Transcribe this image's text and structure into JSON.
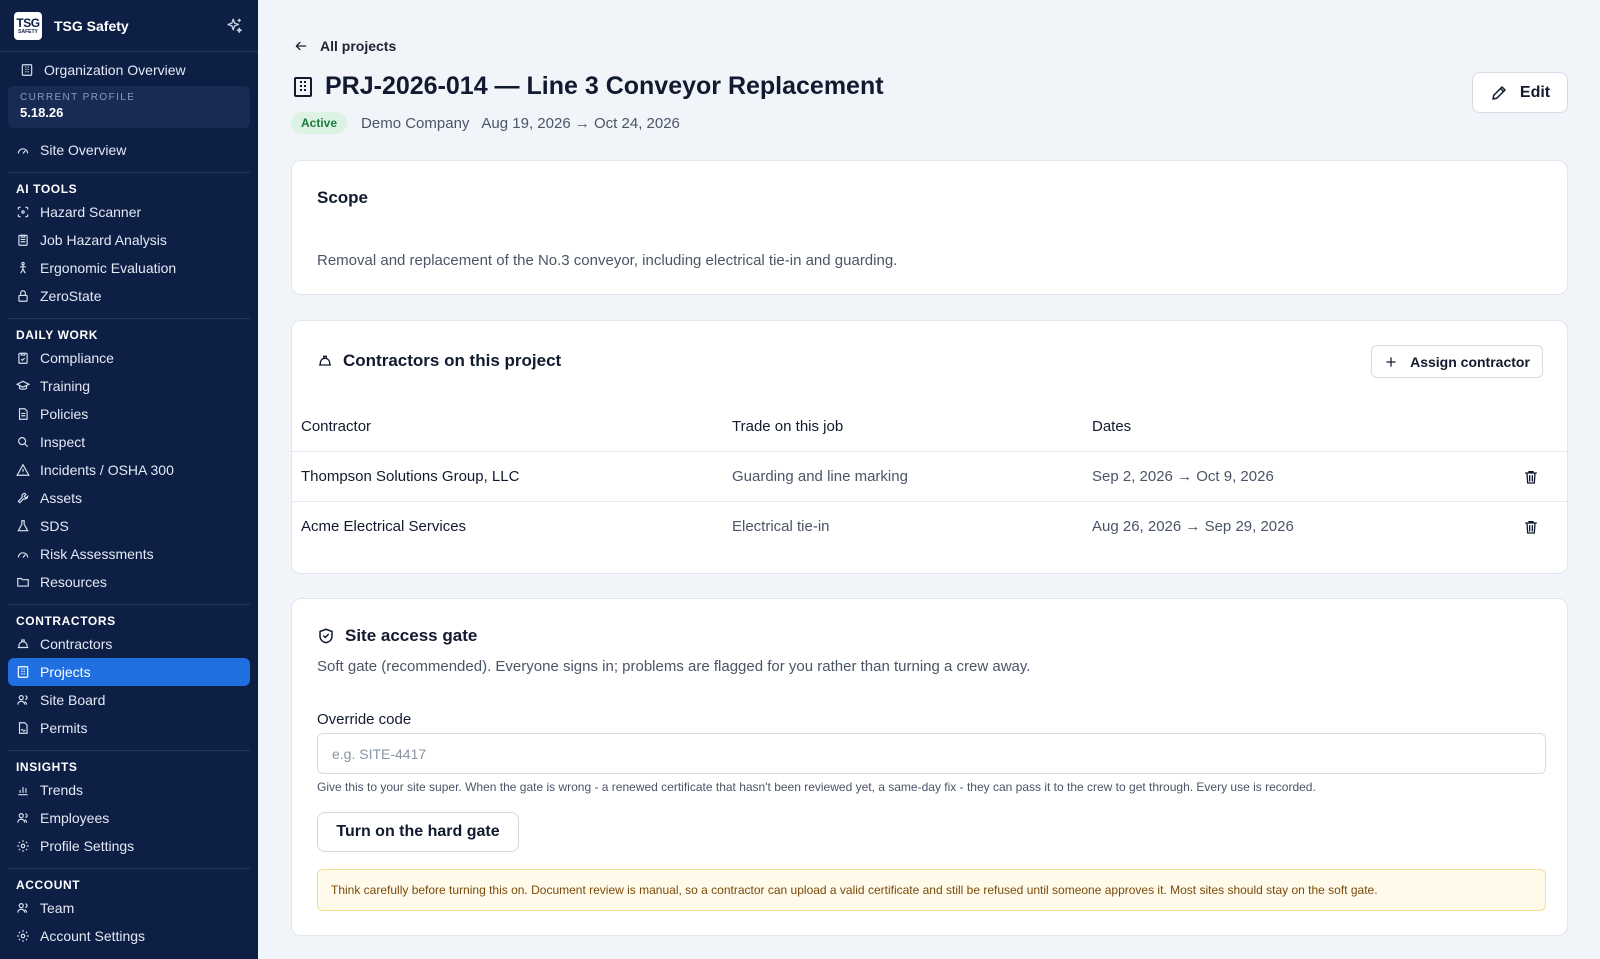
{
  "app": {
    "brand_logo_line1": "TSG",
    "brand_logo_line2": "SAFETY",
    "brand_name": "TSG Safety"
  },
  "sidebar": {
    "org_overview": "Organization Overview",
    "profile_label": "CURRENT PROFILE",
    "profile_value": "5.18.26",
    "site_overview": "Site Overview",
    "sections": {
      "ai_tools": {
        "title": "AI TOOLS",
        "items": [
          "Hazard Scanner",
          "Job Hazard Analysis",
          "Ergonomic Evaluation",
          "ZeroState"
        ]
      },
      "daily_work": {
        "title": "DAILY WORK",
        "items": [
          "Compliance",
          "Training",
          "Policies",
          "Inspect",
          "Incidents / OSHA 300",
          "Assets",
          "SDS",
          "Risk Assessments",
          "Resources"
        ]
      },
      "contractors": {
        "title": "CONTRACTORS",
        "items": [
          "Contractors",
          "Projects",
          "Site Board",
          "Permits"
        ],
        "active": "Projects"
      },
      "insights": {
        "title": "INSIGHTS",
        "items": [
          "Trends",
          "Employees",
          "Profile Settings"
        ]
      },
      "account": {
        "title": "ACCOUNT",
        "items": [
          "Team",
          "Account Settings"
        ]
      }
    }
  },
  "header": {
    "back_label": "All projects",
    "title": "PRJ-2026-014 — Line 3 Conveyor Replacement",
    "status": "Active",
    "company": "Demo Company",
    "dates": "Aug 19, 2026 → Oct 24, 2026",
    "edit_label": "Edit"
  },
  "scope": {
    "title": "Scope",
    "text": "Removal and replacement of the No.3 conveyor, including electrical tie-in and guarding."
  },
  "contractors_card": {
    "title": "Contractors on this project",
    "assign_label": "Assign contractor",
    "columns": [
      "Contractor",
      "Trade on this job",
      "Dates"
    ],
    "rows": [
      {
        "contractor": "Thompson Solutions Group, LLC",
        "trade": "Guarding and line marking",
        "dates": "Sep 2, 2026 → Oct 9, 2026"
      },
      {
        "contractor": "Acme Electrical Services",
        "trade": "Electrical tie-in",
        "dates": "Aug 26, 2026 → Sep 29, 2026"
      }
    ]
  },
  "gate": {
    "title": "Site access gate",
    "description": "Soft gate (recommended). Everyone signs in; problems are flagged for you rather than turning a crew away.",
    "override_label": "Override code",
    "override_placeholder": "e.g. SITE-4417",
    "override_value": "",
    "help": "Give this to your site super. When the gate is wrong - a renewed certificate that hasn't been reviewed yet, a same-day fix - they can pass it to the crew to get through. Every use is recorded.",
    "hard_gate_label": "Turn on the hard gate",
    "warning": "Think carefully before turning this on. Document review is manual, so a contractor can upload a valid certificate and still be refused until someone approves it. Most sites should stay on the soft gate."
  },
  "colors": {
    "sidebar_bg": "#0e1f45",
    "active_nav": "#1f6fe0",
    "badge_bg": "#dcf3e3",
    "badge_text": "#1c7a3c",
    "warning_bg": "#fffaea"
  }
}
